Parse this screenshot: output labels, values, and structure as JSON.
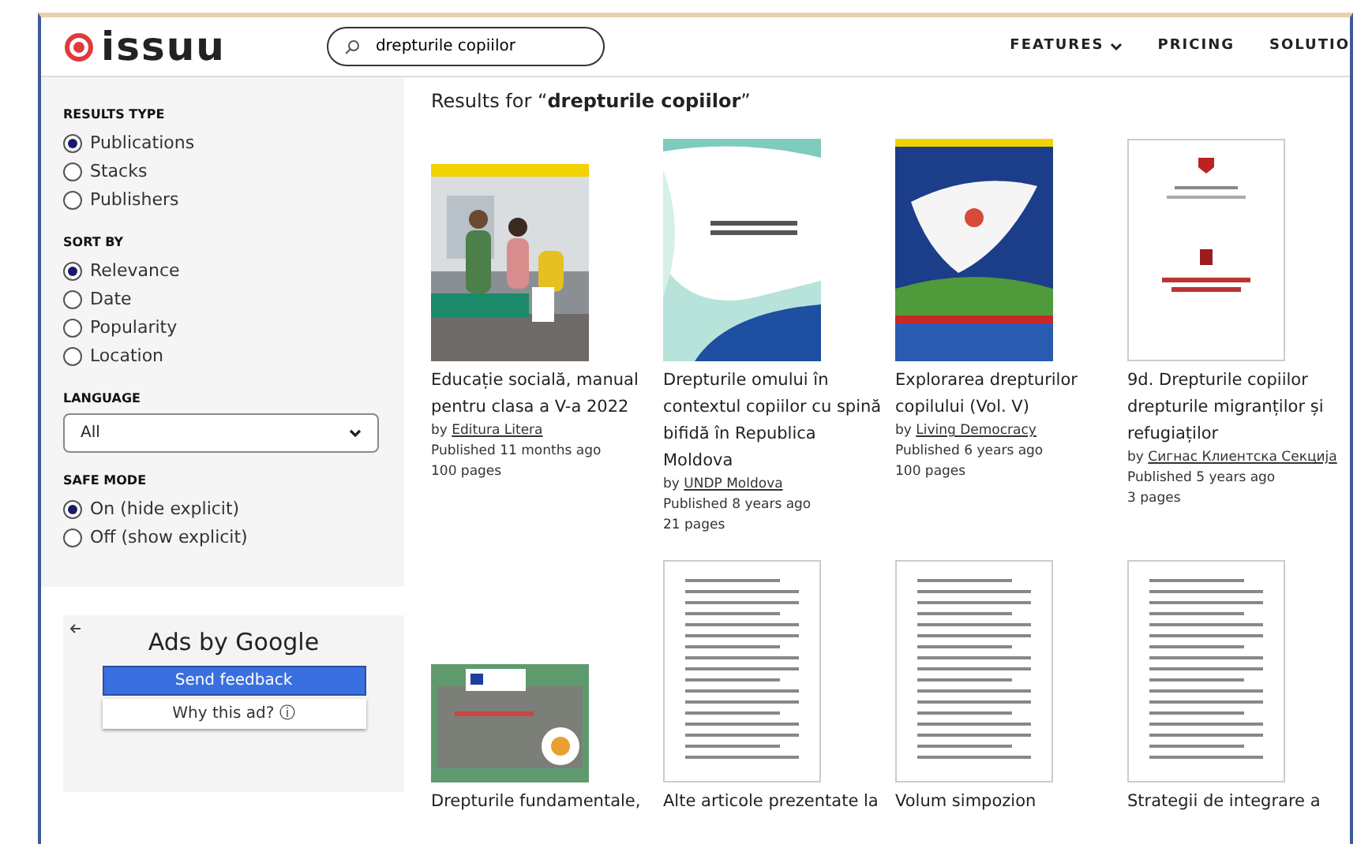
{
  "header": {
    "logo": "issuu",
    "search": {
      "value": "drepturile copiilor"
    },
    "nav": [
      {
        "label": "FEATURES",
        "dropdown": true
      },
      {
        "label": "PRICING",
        "dropdown": false
      },
      {
        "label": "SOLUTIO",
        "dropdown": false
      }
    ]
  },
  "filters": [
    {
      "heading": "RESULTS TYPE",
      "kind": "radio",
      "options": [
        {
          "label": "Publications",
          "selected": true
        },
        {
          "label": "Stacks",
          "selected": false
        },
        {
          "label": "Publishers",
          "selected": false
        }
      ]
    },
    {
      "heading": "SORT BY",
      "kind": "radio",
      "options": [
        {
          "label": "Relevance",
          "selected": true
        },
        {
          "label": "Date",
          "selected": false
        },
        {
          "label": "Popularity",
          "selected": false
        },
        {
          "label": "Location",
          "selected": false
        }
      ]
    },
    {
      "heading": "LANGUAGE",
      "kind": "select",
      "value": "All"
    },
    {
      "heading": "SAFE MODE",
      "kind": "radio",
      "options": [
        {
          "label": "On (hide explicit)",
          "selected": true
        },
        {
          "label": "Off (show explicit)",
          "selected": false
        }
      ]
    }
  ],
  "ad": {
    "title": "Ads by Google",
    "buttons": [
      "Send feedback",
      "Why this ad? ⓘ"
    ]
  },
  "results_heading": "Results for “**drepturile copiilor**”",
  "publications": [
    {
      "title": "Educație socială, manual pentru clasa a V-a 2022",
      "by": "by",
      "publisher": "Editura Litera",
      "published": "Published 11 months ago",
      "pages": "100 pages"
    },
    {
      "title": "Drepturile omului în contextul copiilor cu spină bifidă în Republica Moldova",
      "by": "by",
      "publisher": "UNDP Moldova",
      "published": "Published 8 years ago",
      "pages": "21 pages"
    },
    {
      "title": "Explorarea drepturilor copilului (Vol. V)",
      "by": "by",
      "publisher": "Living Democracy",
      "published": "Published 6 years ago",
      "pages": "100 pages"
    },
    {
      "title": "9d. Drepturile copiilor drepturile migranților și refugiaților",
      "by": "by",
      "publisher": "Сигнас Клиентска Секција",
      "published": "Published 5 years ago",
      "pages": "3 pages"
    },
    {
      "title": "Drepturile fundamentale,"
    },
    {
      "title": "Alte articole prezentate la"
    },
    {
      "title": "Volum simpozion"
    },
    {
      "title": "Strategii de integrare a"
    }
  ]
}
